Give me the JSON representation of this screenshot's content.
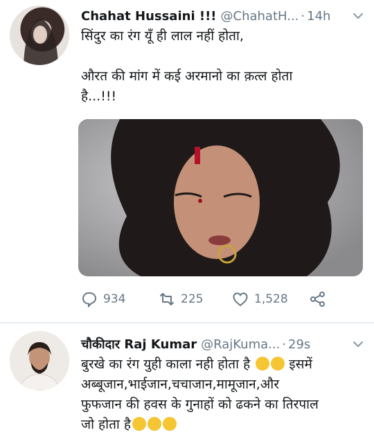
{
  "tweet1": {
    "display_name": "Chahat Hussaini !!!",
    "handle": "@ChahatH...",
    "separator": "·",
    "time": "14h",
    "text_line1": "सिंदुर का रंग यूँ ही लाल नहीं होता,",
    "text_line2": "औरत की मांग में कई अरमानो का क़त्ल होता",
    "text_line3": "है...!!!",
    "replies": "934",
    "retweets": "225",
    "likes": "1,528"
  },
  "tweet2": {
    "display_name": "चौकीदार Raj Kumar",
    "handle": "@RajKuma...",
    "separator": "·",
    "time": "29s",
    "text_line1": "बुरखे का रंग युही काला नही होता है",
    "text_line1_tail": "इसमें",
    "text_line2": "अब्बूजान,भाईजान,चचाजान,मामूजान,और",
    "text_line3": "फुफजान की हवस के गुनाहों को ढकने का तिरपाल",
    "text_line4": "जो होता है"
  },
  "icons": [
    "chevron-down-icon",
    "reply-icon",
    "retweet-icon",
    "like-icon",
    "share-icon",
    "emoji-icon"
  ],
  "colors": {
    "text": "#14171a",
    "muted": "#657786",
    "divider": "#e6ecf0",
    "emoji": "#f5c533"
  }
}
